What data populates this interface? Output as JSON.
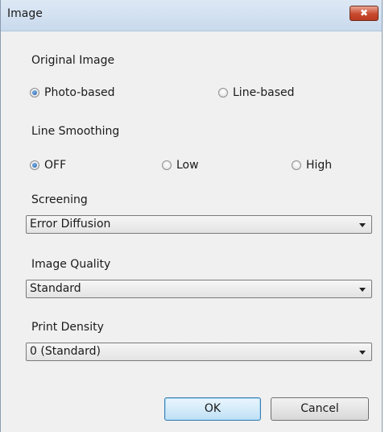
{
  "window": {
    "title": "Image",
    "close_glyph": "✖"
  },
  "original_image": {
    "label": "Original Image",
    "options": [
      {
        "label": "Photo-based",
        "checked": true
      },
      {
        "label": "Line-based",
        "checked": false
      }
    ]
  },
  "line_smoothing": {
    "label": "Line Smoothing",
    "options": [
      {
        "label": "OFF",
        "checked": true
      },
      {
        "label": "Low",
        "checked": false
      },
      {
        "label": "High",
        "checked": false
      }
    ]
  },
  "screening": {
    "label": "Screening",
    "value": "Error Diffusion"
  },
  "image_quality": {
    "label": "Image Quality",
    "value": "Standard"
  },
  "print_density": {
    "label": "Print Density",
    "value": "0 (Standard)"
  },
  "buttons": {
    "ok": "OK",
    "cancel": "Cancel"
  },
  "colors": {
    "close_button": "#c94a2e",
    "radio_selected": "#1f5fa8",
    "title_bar": "#dde8f4"
  }
}
